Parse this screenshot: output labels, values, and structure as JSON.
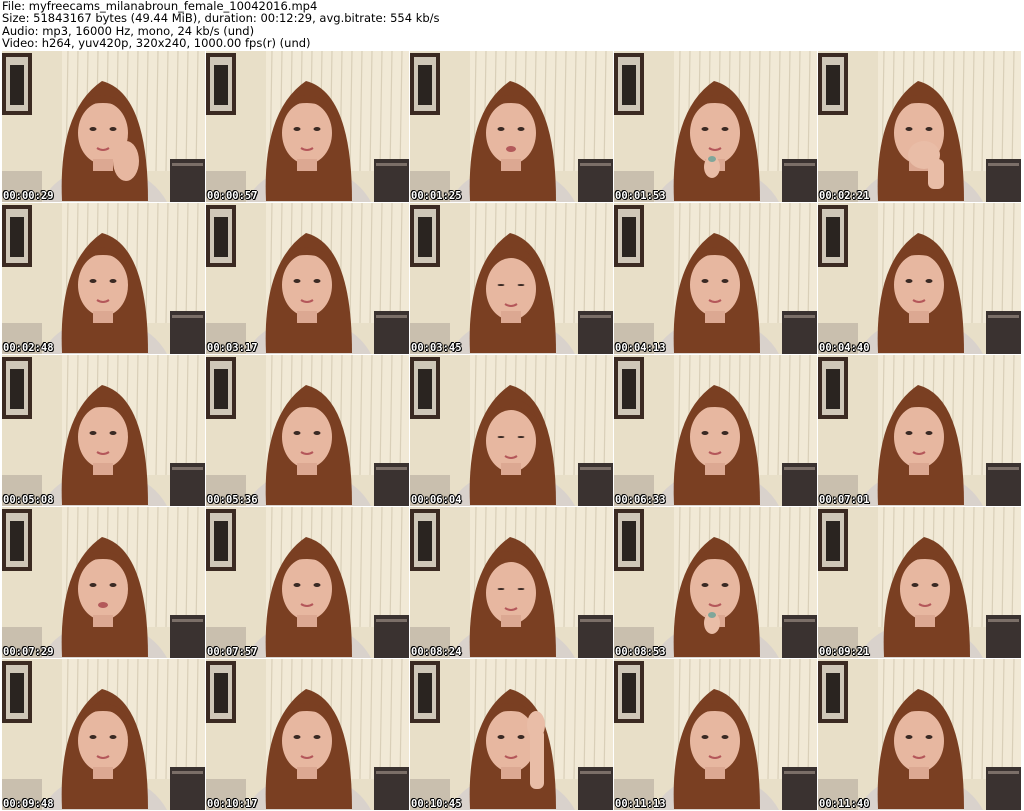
{
  "header": {
    "file_line": "File: myfreecams_milanabroun_female_10042016.mp4",
    "size_line": "Size: 51843167 bytes (49.44 MiB), duration: 00:12:29, avg.bitrate: 554 kb/s",
    "audio_line": "Audio: mp3, 16000 Hz, mono, 24 kb/s (und)",
    "video_line": "Video: h264, yuv420p, 320x240, 1000.00 fps(r) (und)"
  },
  "thumbnails": [
    {
      "timestamp": "00:00:29",
      "pose": "hand-on-cheek"
    },
    {
      "timestamp": "00:00:57",
      "pose": "neutral"
    },
    {
      "timestamp": "00:01:25",
      "pose": "talking"
    },
    {
      "timestamp": "00:01:53",
      "pose": "hand-at-chin"
    },
    {
      "timestamp": "00:02:21",
      "pose": "hand-over-mouth"
    },
    {
      "timestamp": "00:02:48",
      "pose": "neutral"
    },
    {
      "timestamp": "00:03:17",
      "pose": "neutral"
    },
    {
      "timestamp": "00:03:45",
      "pose": "looking-down"
    },
    {
      "timestamp": "00:04:13",
      "pose": "neutral"
    },
    {
      "timestamp": "00:04:40",
      "pose": "neutral"
    },
    {
      "timestamp": "00:05:08",
      "pose": "neutral"
    },
    {
      "timestamp": "00:05:36",
      "pose": "neutral"
    },
    {
      "timestamp": "00:06:04",
      "pose": "looking-down"
    },
    {
      "timestamp": "00:06:33",
      "pose": "neutral"
    },
    {
      "timestamp": "00:07:01",
      "pose": "neutral"
    },
    {
      "timestamp": "00:07:29",
      "pose": "talking"
    },
    {
      "timestamp": "00:07:57",
      "pose": "neutral"
    },
    {
      "timestamp": "00:08:24",
      "pose": "looking-down"
    },
    {
      "timestamp": "00:08:53",
      "pose": "hand-at-chin"
    },
    {
      "timestamp": "00:09:21",
      "pose": "head-tilt"
    },
    {
      "timestamp": "00:09:48",
      "pose": "neutral"
    },
    {
      "timestamp": "00:10:17",
      "pose": "neutral"
    },
    {
      "timestamp": "00:10:45",
      "pose": "hand-on-forehead"
    },
    {
      "timestamp": "00:11:13",
      "pose": "neutral"
    },
    {
      "timestamp": "00:11:40",
      "pose": "neutral"
    }
  ],
  "colors": {
    "wall": "#e8dfc8",
    "curtain": "#f1e9d6",
    "frame": "#3b2a22",
    "hair": "#7a3f22",
    "skin": "#e7b7a0",
    "sofa": "#3a3230",
    "shirt": "#d9d2cc"
  }
}
